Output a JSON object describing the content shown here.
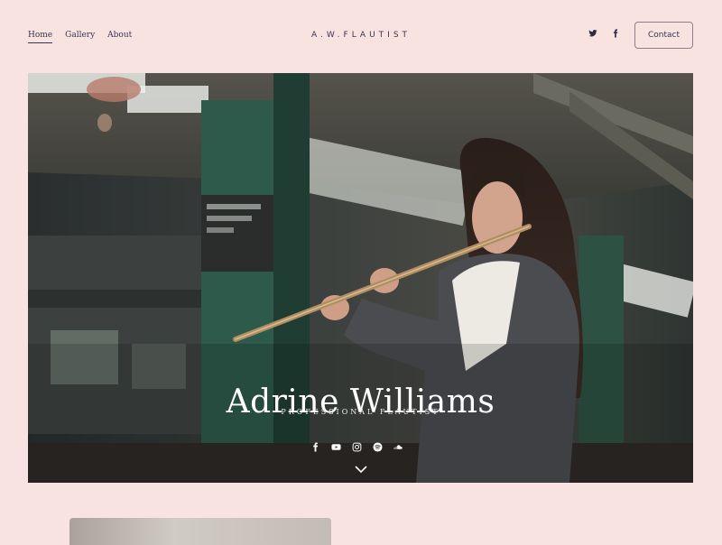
{
  "nav": {
    "home": "Home",
    "gallery": "Gallery",
    "about": "About"
  },
  "brand": "A.W.FLAUTIST",
  "header_social": [
    "twitter-icon",
    "facebook-icon"
  ],
  "contact_label": "Contact",
  "hero": {
    "name": "Adrine Williams",
    "subtitle": "PROFESSIONAL FLAUTIST",
    "social_icons": [
      "facebook-icon",
      "youtube-icon",
      "instagram-icon",
      "spotify-icon",
      "soundcloud-icon"
    ]
  },
  "colors": {
    "background": "#f9e3e1",
    "text": "#3a3450",
    "hero_text": "#ffffff"
  }
}
